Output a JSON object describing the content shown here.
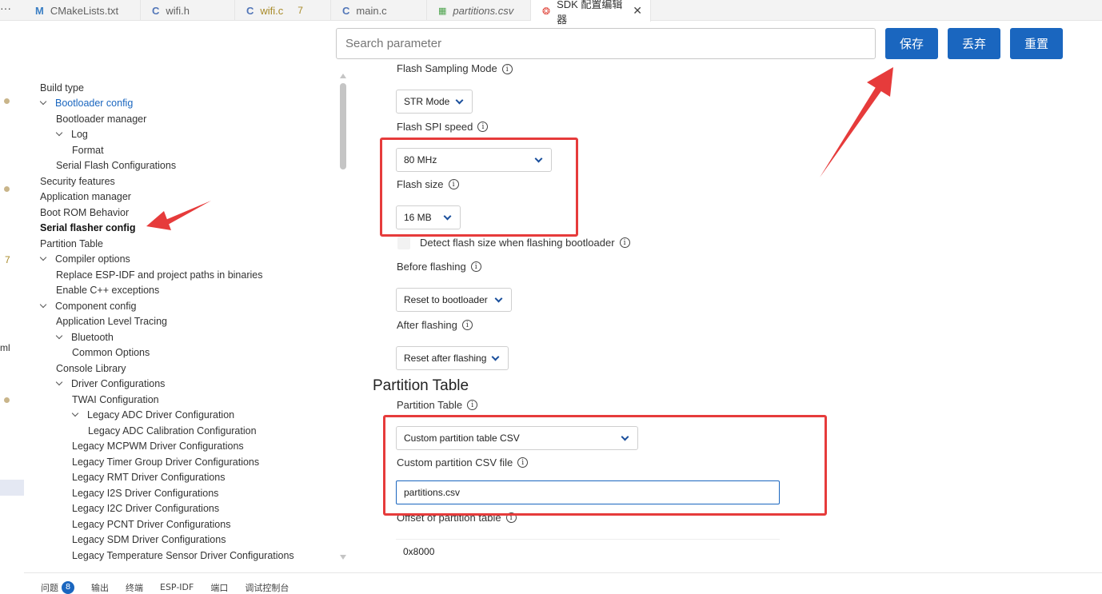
{
  "tabs": [
    {
      "icon": "M",
      "label": "CMakeLists.txt",
      "badge": ""
    },
    {
      "icon": "C",
      "label": "wifi.h",
      "badge": ""
    },
    {
      "icon": "C",
      "label": "wifi.c",
      "badge": "7"
    },
    {
      "icon": "C",
      "label": "main.c",
      "badge": ""
    },
    {
      "icon": "▦",
      "label": "partitions.csv",
      "badge": ""
    },
    {
      "icon": "❂",
      "label": "SDK 配置编辑器",
      "close": "✕"
    }
  ],
  "tab_more": "···",
  "gutter": {
    "badge_7": "7",
    "ml": "ml"
  },
  "search": {
    "placeholder": "Search parameter",
    "value": ""
  },
  "buttons": {
    "save": "保存",
    "discard": "丢弃",
    "reset": "重置"
  },
  "tree": [
    {
      "label": "Build type"
    },
    {
      "label": "Bootloader config",
      "expanded": true,
      "link": true
    },
    {
      "label": "Bootloader manager"
    },
    {
      "label": "Log",
      "expanded": true
    },
    {
      "label": "Format"
    },
    {
      "label": "Serial Flash Configurations"
    },
    {
      "label": "Security features"
    },
    {
      "label": "Application manager"
    },
    {
      "label": "Boot ROM Behavior"
    },
    {
      "label": "Serial flasher config",
      "selected": true
    },
    {
      "label": "Partition Table"
    },
    {
      "label": "Compiler options",
      "expanded": true
    },
    {
      "label": "Replace ESP-IDF and project paths in binaries"
    },
    {
      "label": "Enable C++ exceptions"
    },
    {
      "label": "Component config",
      "expanded": true
    },
    {
      "label": "Application Level Tracing"
    },
    {
      "label": "Bluetooth",
      "expanded": true
    },
    {
      "label": "Common Options"
    },
    {
      "label": "Console Library"
    },
    {
      "label": "Driver Configurations",
      "expanded": true
    },
    {
      "label": "TWAI Configuration"
    },
    {
      "label": "Legacy ADC Driver Configuration",
      "expanded": true
    },
    {
      "label": "Legacy ADC Calibration Configuration"
    },
    {
      "label": "Legacy MCPWM Driver Configurations"
    },
    {
      "label": "Legacy Timer Group Driver Configurations"
    },
    {
      "label": "Legacy RMT Driver Configurations"
    },
    {
      "label": "Legacy I2S Driver Configurations"
    },
    {
      "label": "Legacy I2C Driver Configurations"
    },
    {
      "label": "Legacy PCNT Driver Configurations"
    },
    {
      "label": "Legacy SDM Driver Configurations"
    },
    {
      "label": "Legacy Temperature Sensor Driver Configurations"
    }
  ],
  "form": {
    "flash_sampling_mode_label": "Flash Sampling Mode",
    "flash_sampling_mode_value": "STR Mode",
    "flash_spi_speed_label": "Flash SPI speed",
    "flash_spi_speed_value": "80 MHz",
    "flash_size_label": "Flash size",
    "flash_size_value": "16 MB",
    "detect_flash_label": "Detect flash size when flashing bootloader",
    "before_flashing_label": "Before flashing",
    "before_flashing_value": "Reset to bootloader",
    "after_flashing_label": "After flashing",
    "after_flashing_value": "Reset after flashing",
    "partition_section_title": "Partition Table",
    "partition_table_label": "Partition Table",
    "partition_table_value": "Custom partition table CSV",
    "custom_csv_label": "Custom partition CSV file",
    "custom_csv_value": "partitions.csv",
    "offset_label": "Offset of partition table",
    "offset_value": "0x8000",
    "info_glyph": "i"
  },
  "bottom_panel": {
    "problems": "问题",
    "problems_count": "8",
    "output": "输出",
    "terminal": "终端",
    "espidf": "ESP-IDF",
    "port": "端口",
    "debug_console": "调试控制台"
  },
  "colors": {
    "accent": "#1a66bf",
    "annotation": "#e63b3b"
  }
}
